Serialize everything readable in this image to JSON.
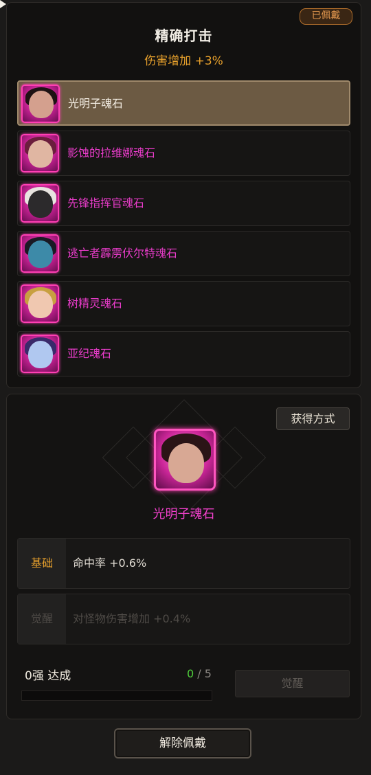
{
  "header": {
    "equipped_badge": "已佩戴",
    "title": "精确打击",
    "effect": "伤害增加 +3%"
  },
  "stones": [
    {
      "name": "光明子魂石",
      "selected": true,
      "portrait": {
        "face": "#d4a08e",
        "hair": "#1e1214"
      }
    },
    {
      "name": "影蚀的拉维娜魂石",
      "selected": false,
      "portrait": {
        "face": "#e0b6a2",
        "hair": "#6b1e3d"
      }
    },
    {
      "name": "先锋指挥官魂石",
      "selected": false,
      "portrait": {
        "face": "#2c2a2c",
        "hair": "#e8e4e0"
      }
    },
    {
      "name": "逃亡者霹雳伏尔特魂石",
      "selected": false,
      "portrait": {
        "face": "#3d8aa8",
        "hair": "#1a1a24"
      }
    },
    {
      "name": "树精灵魂石",
      "selected": false,
      "portrait": {
        "face": "#f0c8b0",
        "hair": "#c8a040"
      }
    },
    {
      "name": "亚纪魂石",
      "selected": false,
      "portrait": {
        "face": "#b0c8f0",
        "hair": "#3a2a6a"
      }
    }
  ],
  "detail": {
    "obtain_button": "获得方式",
    "selected_name": "光明子魂石",
    "base": {
      "tag": "基础",
      "text": "命中率 +0.6%"
    },
    "awaken": {
      "tag": "觉醒",
      "text": "对怪物伤害增加 +0.4%"
    },
    "progress": {
      "label": "0强 达成",
      "current": "0",
      "separator": "/",
      "total": "5",
      "fraction": 0
    },
    "awaken_button": "觉醒"
  },
  "footer": {
    "unequip_button": "解除佩戴"
  },
  "colors": {
    "accent_pink": "#ea3ccb",
    "gold": "#e8a12c",
    "green": "#4fcf3b"
  }
}
